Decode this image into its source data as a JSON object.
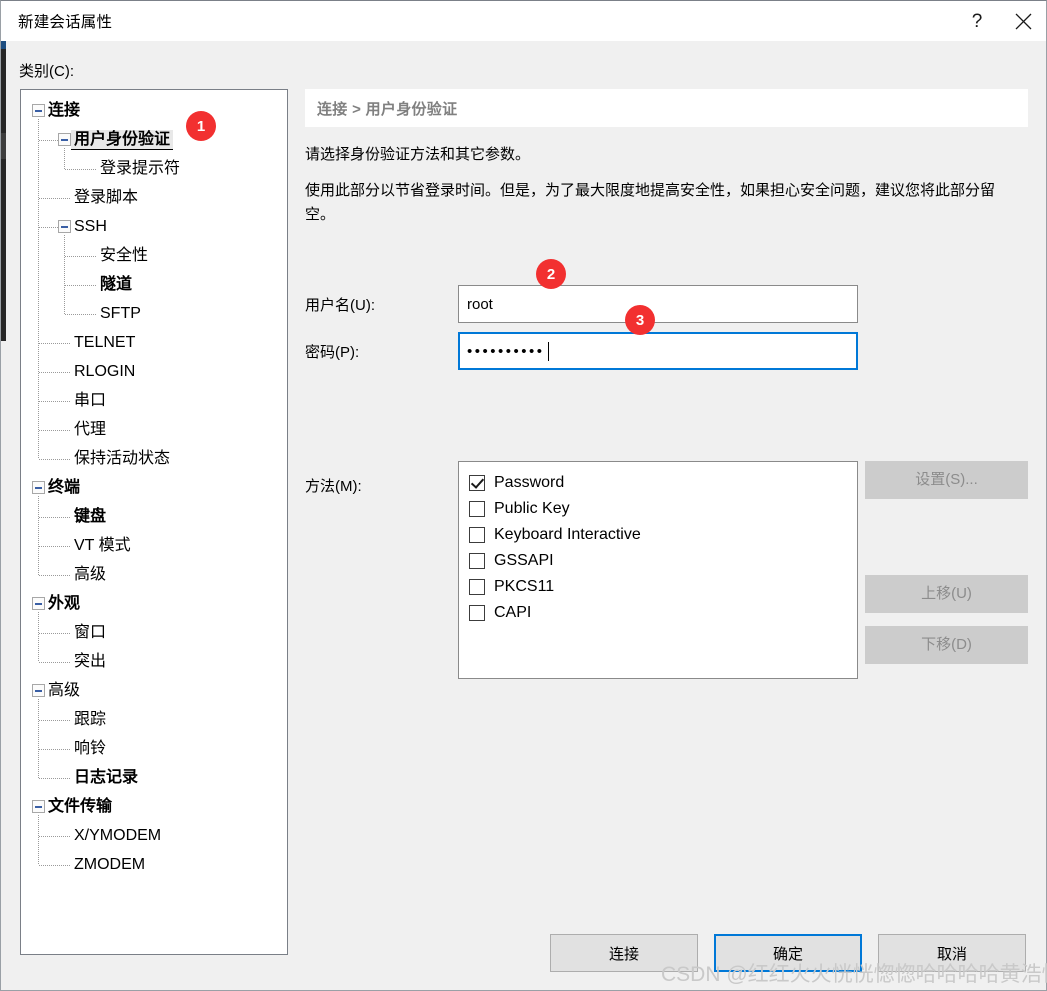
{
  "window": {
    "title": "新建会话属性",
    "help_icon": "question-mark-icon",
    "close_icon": "close-icon"
  },
  "category": {
    "label": "类别(C):",
    "tree": [
      {
        "label": "连接",
        "level": 0,
        "bold": true,
        "expander": "minus",
        "selected": false
      },
      {
        "label": "用户身份验证",
        "level": 1,
        "bold": true,
        "expander": "minus",
        "selected": true
      },
      {
        "label": "登录提示符",
        "level": 2,
        "bold": false,
        "expander": "none",
        "selected": false
      },
      {
        "label": "登录脚本",
        "level": 1,
        "bold": false,
        "expander": "none",
        "selected": false
      },
      {
        "label": "SSH",
        "level": 1,
        "bold": false,
        "expander": "minus",
        "selected": false
      },
      {
        "label": "安全性",
        "level": 2,
        "bold": false,
        "expander": "none",
        "selected": false
      },
      {
        "label": "隧道",
        "level": 2,
        "bold": true,
        "expander": "none",
        "selected": false
      },
      {
        "label": "SFTP",
        "level": 2,
        "bold": false,
        "expander": "none",
        "selected": false
      },
      {
        "label": "TELNET",
        "level": 1,
        "bold": false,
        "expander": "none",
        "selected": false
      },
      {
        "label": "RLOGIN",
        "level": 1,
        "bold": false,
        "expander": "none",
        "selected": false
      },
      {
        "label": "串口",
        "level": 1,
        "bold": false,
        "expander": "none",
        "selected": false
      },
      {
        "label": "代理",
        "level": 1,
        "bold": false,
        "expander": "none",
        "selected": false
      },
      {
        "label": "保持活动状态",
        "level": 1,
        "bold": false,
        "expander": "none",
        "selected": false
      },
      {
        "label": "终端",
        "level": 0,
        "bold": true,
        "expander": "minus",
        "selected": false
      },
      {
        "label": "键盘",
        "level": 1,
        "bold": true,
        "expander": "none",
        "selected": false
      },
      {
        "label": "VT 模式",
        "level": 1,
        "bold": false,
        "expander": "none",
        "selected": false
      },
      {
        "label": "高级",
        "level": 1,
        "bold": false,
        "expander": "none",
        "selected": false
      },
      {
        "label": "外观",
        "level": 0,
        "bold": true,
        "expander": "minus",
        "selected": false
      },
      {
        "label": "窗口",
        "level": 1,
        "bold": false,
        "expander": "none",
        "selected": false
      },
      {
        "label": "突出",
        "level": 1,
        "bold": false,
        "expander": "none",
        "selected": false
      },
      {
        "label": "高级",
        "level": 0,
        "bold": false,
        "expander": "minus",
        "selected": false
      },
      {
        "label": "跟踪",
        "level": 1,
        "bold": false,
        "expander": "none",
        "selected": false
      },
      {
        "label": "响铃",
        "level": 1,
        "bold": false,
        "expander": "none",
        "selected": false
      },
      {
        "label": "日志记录",
        "level": 1,
        "bold": true,
        "expander": "none",
        "selected": false
      },
      {
        "label": "文件传输",
        "level": 0,
        "bold": true,
        "expander": "minus",
        "selected": false
      },
      {
        "label": "X/YMODEM",
        "level": 1,
        "bold": false,
        "expander": "none",
        "selected": false
      },
      {
        "label": "ZMODEM",
        "level": 1,
        "bold": false,
        "expander": "none",
        "selected": false
      }
    ]
  },
  "pane": {
    "breadcrumb": "连接 > 用户身份验证",
    "description_1": "请选择身份验证方法和其它参数。",
    "description_2": "使用此部分以节省登录时间。但是，为了最大限度地提高安全性，如果担心安全问题，建议您将此部分留空。",
    "username": {
      "label": "用户名(U):",
      "value": "root",
      "placeholder": ""
    },
    "password": {
      "label": "密码(P):",
      "value": "••••••••••",
      "dot_count": 10,
      "focused": true
    },
    "method": {
      "label": "方法(M):",
      "items": [
        {
          "label": "Password",
          "checked": true
        },
        {
          "label": "Public Key",
          "checked": false
        },
        {
          "label": "Keyboard Interactive",
          "checked": false
        },
        {
          "label": "GSSAPI",
          "checked": false
        },
        {
          "label": "PKCS11",
          "checked": false
        },
        {
          "label": "CAPI",
          "checked": false
        }
      ]
    },
    "side_buttons": [
      {
        "label": "设置(S)...",
        "enabled": false
      },
      {
        "label": "上移(U)",
        "enabled": false
      },
      {
        "label": "下移(D)",
        "enabled": false
      }
    ]
  },
  "footer": {
    "buttons": [
      {
        "label": "连接",
        "default": false
      },
      {
        "label": "确定",
        "default": true
      },
      {
        "label": "取消",
        "default": false
      }
    ]
  },
  "annotations": {
    "badges": [
      {
        "number": "1",
        "target": "用户身份验证"
      },
      {
        "number": "2",
        "target": "用户名(U)"
      },
      {
        "number": "3",
        "target": "密码(P)"
      }
    ],
    "accent_color": "#f23030",
    "focus_color": "#0078d7"
  },
  "watermark": {
    "text": "CSDN @红红火火恍恍惚惚哈哈哈哈黄浩恒"
  }
}
